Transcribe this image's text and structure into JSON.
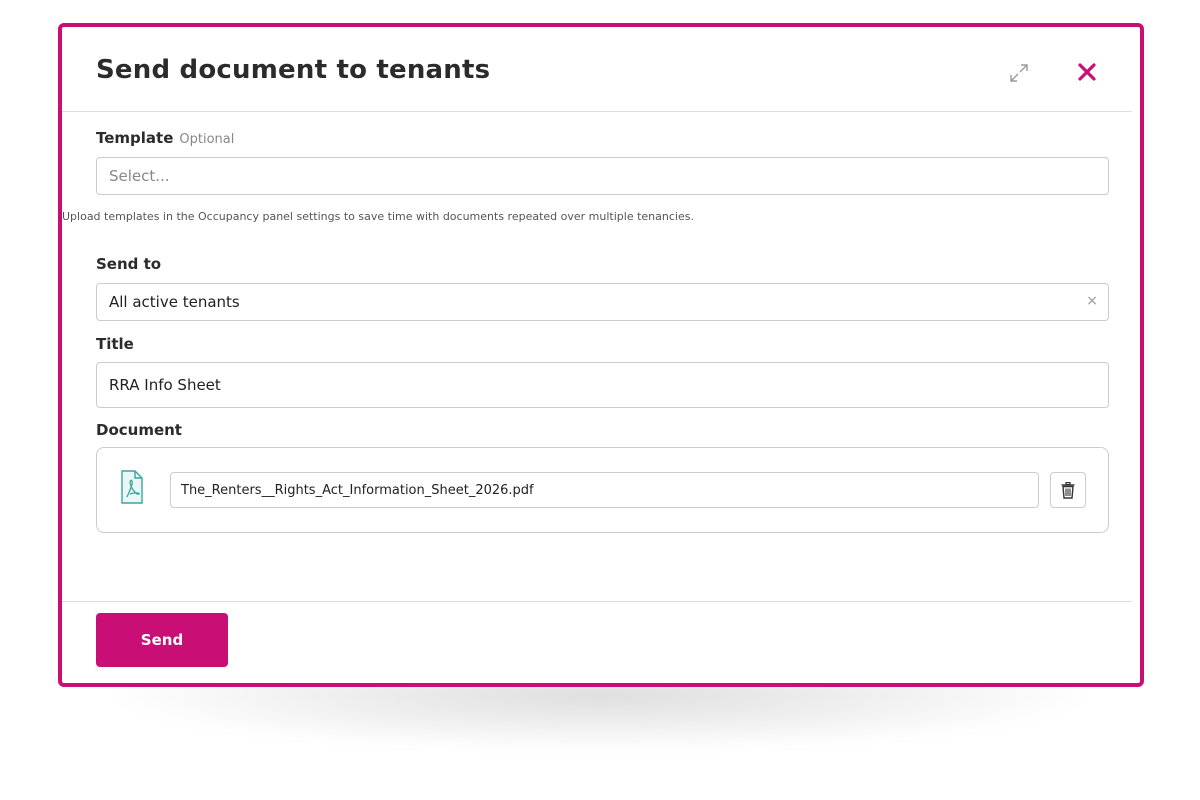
{
  "modal": {
    "title": "Send document to tenants",
    "expand_icon": "expand-icon",
    "close_icon": "close-icon",
    "accent_color": "#c90f76"
  },
  "template": {
    "label": "Template",
    "optional_label": "Optional",
    "placeholder": "Select...",
    "help_text": "Upload templates in the Occupancy panel settings to save time with documents repeated over multiple tenancies."
  },
  "send_to": {
    "label": "Send to",
    "value": "All active tenants",
    "clear_symbol": "×"
  },
  "title_field": {
    "label": "Title",
    "value": "RRA Info Sheet"
  },
  "document": {
    "label": "Document",
    "file_icon": "pdf-file-icon",
    "file_name": "The_Renters__Rights_Act_Information_Sheet_2026.pdf",
    "delete_icon": "trash-icon"
  },
  "footer": {
    "send_label": "Send"
  }
}
